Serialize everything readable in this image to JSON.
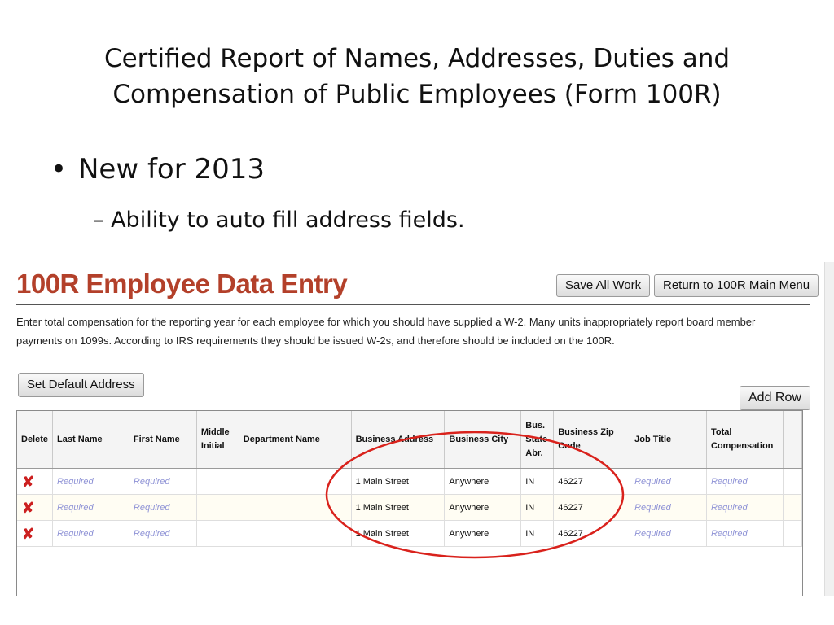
{
  "slide": {
    "title": "Certified Report of Names, Addresses, Duties and Compensation of Public Employees (Form 100R)",
    "bullet": "New for 2013",
    "subbullet": "– Ability to auto fill address fields."
  },
  "app": {
    "title": "100R Employee Data Entry",
    "save_label": "Save All Work",
    "return_label": "Return to 100R Main Menu",
    "instructions": "Enter total compensation for the reporting year for each employee for which you should have supplied a W-2. Many units inappropriately report board member payments on 1099s. According to IRS requirements they should be issued W-2s, and therefore should be included on the 100R.",
    "default_address_label": "Set Default Address",
    "add_row_label": "Add Row"
  },
  "table": {
    "headers": {
      "delete": "Delete",
      "last_name": "Last Name",
      "first_name": "First Name",
      "middle_initial": "Middle Initial",
      "department": "Department Name",
      "address": "Business Address",
      "city": "Business City",
      "state": "Bus. State Abr.",
      "zip": "Business Zip Code",
      "job_title": "Job Title",
      "compensation": "Total Compensation"
    },
    "rows": [
      {
        "last_name": "Required",
        "first_name": "Required",
        "middle_initial": "",
        "department": "",
        "address": "1 Main Street",
        "city": "Anywhere",
        "state": "IN",
        "zip": "46227",
        "job_title": "Required",
        "compensation": "Required"
      },
      {
        "last_name": "Required",
        "first_name": "Required",
        "middle_initial": "",
        "department": "",
        "address": "1 Main Street",
        "city": "Anywhere",
        "state": "IN",
        "zip": "46227",
        "job_title": "Required",
        "compensation": "Required"
      },
      {
        "last_name": "Required",
        "first_name": "Required",
        "middle_initial": "",
        "department": "",
        "address": "1 Main Street",
        "city": "Anywhere",
        "state": "IN",
        "zip": "46227",
        "job_title": "Required",
        "compensation": "Required"
      }
    ]
  },
  "colors": {
    "app_title": "#b3402a",
    "delete_icon": "#cc2020",
    "required_placeholder": "#8f93d6",
    "annotation": "#d9221c"
  },
  "icons": {
    "delete": "delete-x-icon"
  }
}
